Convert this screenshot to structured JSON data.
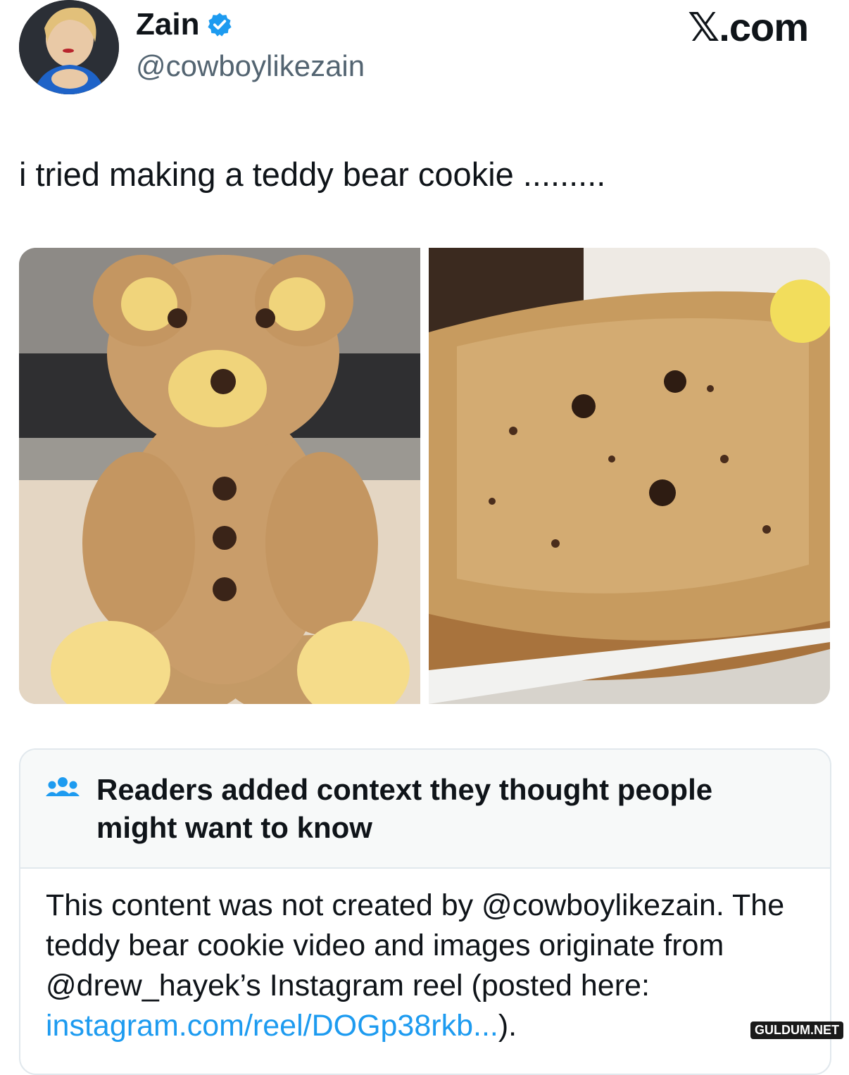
{
  "header": {
    "name": "Zain",
    "handle": "@cowboylikezain",
    "brand": "𝕏.com",
    "verified_icon": "verified-badge-icon",
    "verified_color": "#1d9bf0"
  },
  "tweet": {
    "text": "i tried making a teddy bear cookie ........."
  },
  "community_note": {
    "icon": "people-icon",
    "title": "Readers added context they thought people might want to know",
    "body_prefix": "This content was not created by @cowboylikezain. The teddy bear cookie video and images originate from @drew_hayek’s Instagram reel (posted here: ",
    "link_text": "instagram.com/reel/DOGp38rkb...",
    "body_suffix": ").",
    "link_color": "#1d9bf0"
  },
  "watermark": "GULDUM.NET"
}
